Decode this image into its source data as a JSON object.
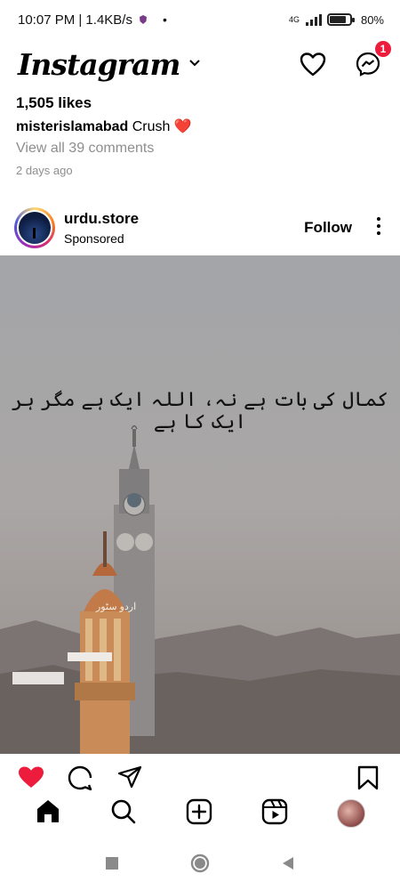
{
  "status_bar": {
    "time": "10:07 PM | 1.4KB/s",
    "network_type": "4G",
    "battery": "80%"
  },
  "header": {
    "logo": "Instagram",
    "messenger_badge": "1",
    "icons": [
      "chevron-down-icon",
      "heart-icon",
      "messenger-icon"
    ]
  },
  "previous_post": {
    "likes": "1,505 likes",
    "caption_user": "misterislamabad",
    "caption_text": "Crush",
    "caption_emoji": "❤️",
    "comments": "View all 39 comments",
    "time": "2 days ago"
  },
  "post": {
    "account_name": "urdu.store",
    "sponsored": "Sponsored",
    "follow_label": "Follow",
    "quote": "کمال کی بات ہے نہ، اللہ ایک ہے مگر ہر ایک کا ہے",
    "watermark": "اردو سٹور"
  },
  "post_actions": [
    "heart-filled-icon",
    "comment-icon",
    "share-icon",
    "bookmark-icon"
  ],
  "colors": {
    "like_red": "#ed1b3c",
    "badge_red": "#ed1b3c",
    "muted_text": "#8e8e8e"
  },
  "bottom_nav": [
    "home-icon",
    "search-icon",
    "new-post-icon",
    "reels-icon",
    "profile-avatar"
  ],
  "system_nav": [
    "recents-button",
    "home-button",
    "back-button"
  ]
}
